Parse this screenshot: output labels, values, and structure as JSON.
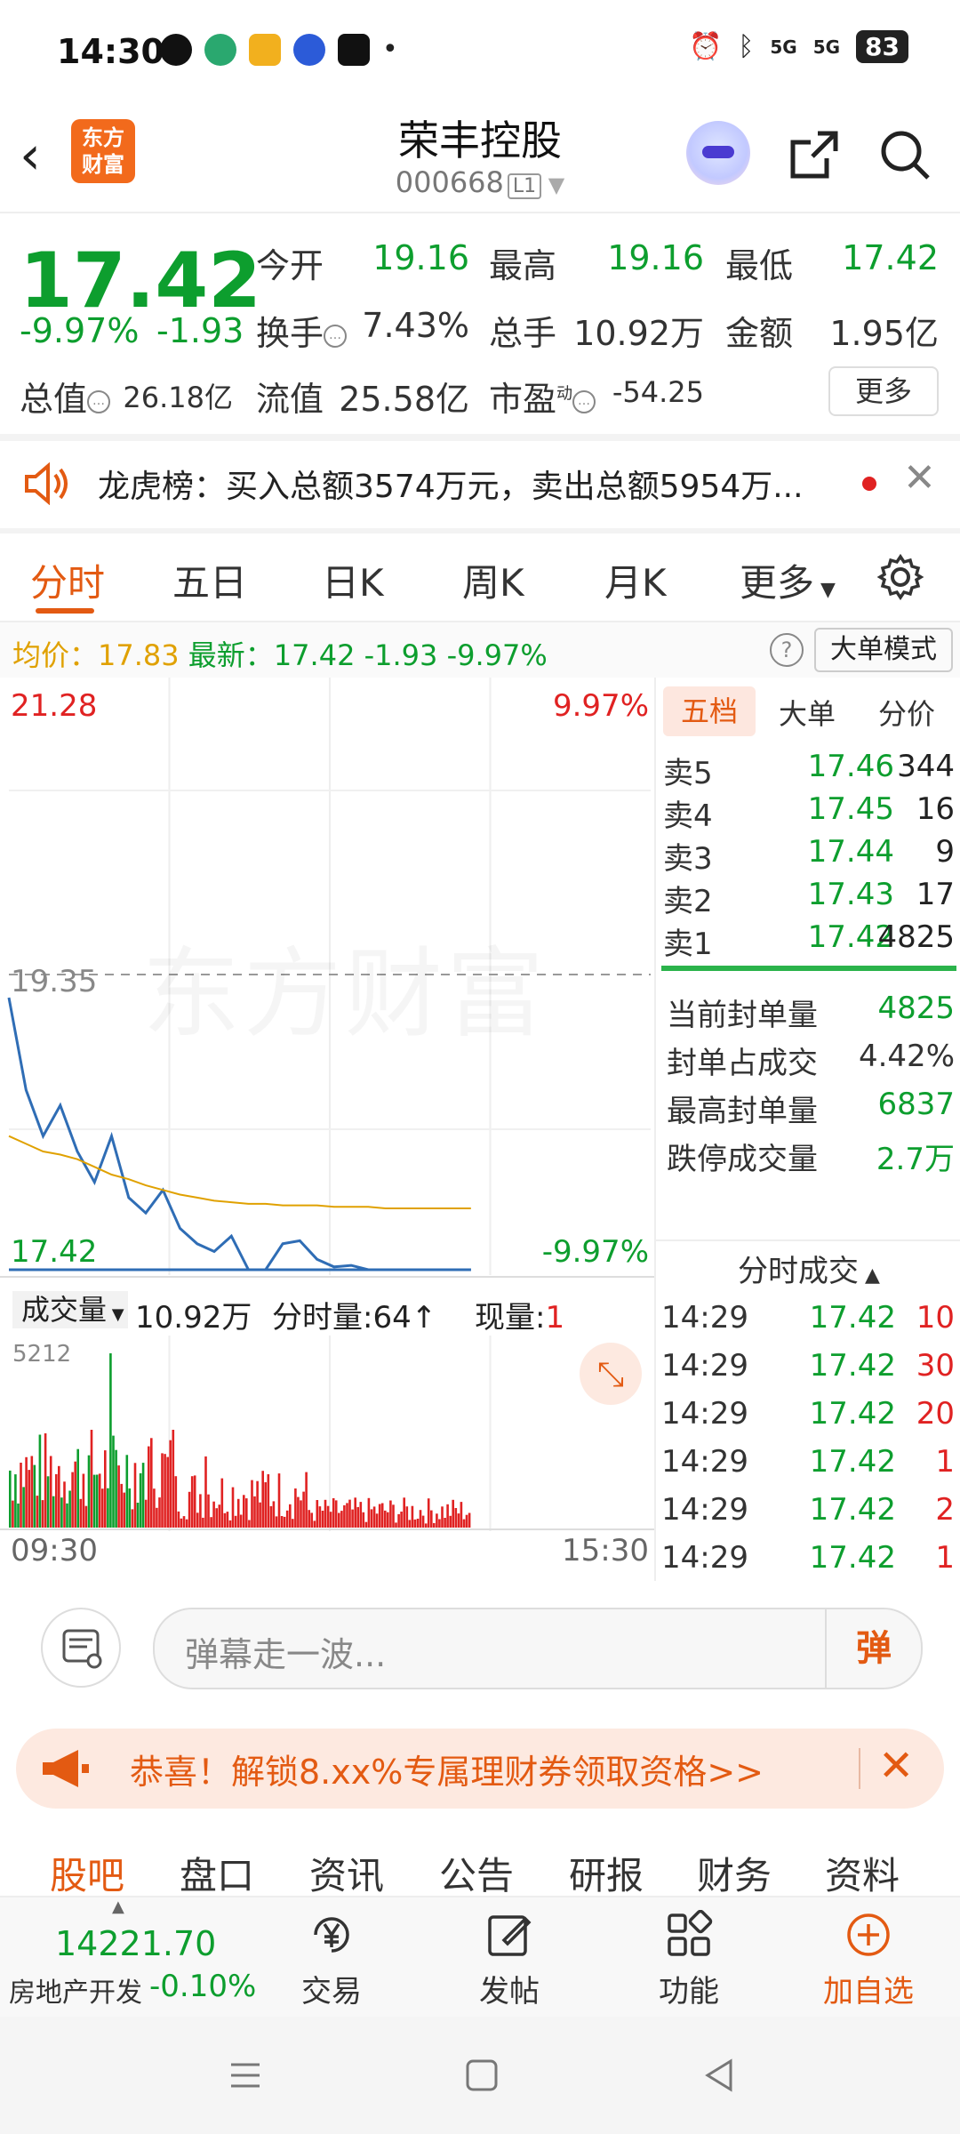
{
  "status_bar": {
    "time": "14:30",
    "battery": "83",
    "signal_labels": [
      "5G",
      "5G"
    ]
  },
  "header": {
    "title": "荣丰控股",
    "code": "000668",
    "level": "L1",
    "logo_line1": "东方",
    "logo_line2": "财富"
  },
  "quote": {
    "price": "17.42",
    "change_pct": "-9.97%",
    "change": "-1.93",
    "open_label": "今开",
    "open": "19.16",
    "high_label": "最高",
    "high": "19.16",
    "low_label": "最低",
    "low": "17.42",
    "turnover_label": "换手",
    "turnover": "7.43%",
    "volume_label": "总手",
    "volume": "10.92万",
    "amount_label": "金额",
    "amount": "1.95亿",
    "mktcap_label": "总值",
    "mktcap": "26.18亿",
    "float_label": "流值",
    "float_cap": "25.58亿",
    "pe_label": "市盈",
    "pe_sup": "动",
    "pe": "-54.25",
    "more_label": "更多"
  },
  "banner": {
    "text": "龙虎榜：买入总额3574万元，卖出总额5954万..."
  },
  "tabs": [
    "分时",
    "五日",
    "日K",
    "周K",
    "月K",
    "更多"
  ],
  "avgline": {
    "avg_label": "均价：",
    "avg": "17.83",
    "latest_label": "最新：",
    "latest": "17.42",
    "chg": "-1.93",
    "pct": "-9.97%",
    "big_mode": "大单模式"
  },
  "chart": {
    "top_price": "21.28",
    "top_pct": "9.97%",
    "ref_price": "19.35",
    "bottom_price": "17.42",
    "bottom_pct": "-9.97%",
    "watermark": "东方财富",
    "vol_label": "成交量",
    "vol_total": "10.92万",
    "tick_vol_label": "分时量:",
    "tick_vol": "64",
    "now_label": "现量:",
    "now_vol": "1",
    "vol_max": "5212",
    "start_time": "09:30",
    "end_time": "15:30"
  },
  "chart_data": {
    "type": "line",
    "series": [
      {
        "values": [
          19.2,
          18.6,
          18.3,
          18.5,
          18.2,
          18.0,
          18.3,
          17.9,
          17.8,
          17.95,
          17.7,
          17.6,
          17.55,
          17.65,
          17.42,
          17.42,
          17.6,
          17.62,
          17.5,
          17.45,
          17.46,
          17.42,
          17.42,
          17.42,
          17.42,
          17.42,
          17.42,
          17.42
        ]
      },
      {
        "values": [
          18.3,
          18.25,
          18.2,
          18.18,
          18.15,
          18.1,
          18.05,
          18.02,
          17.98,
          17.95,
          17.92,
          17.9,
          17.88,
          17.87,
          17.86,
          17.86,
          17.85,
          17.85,
          17.85,
          17.84,
          17.84,
          17.84,
          17.83,
          17.83,
          17.83,
          17.83,
          17.83,
          17.83
        ]
      }
    ],
    "ylim": [
      17.42,
      21.28
    ],
    "reference": 19.35,
    "xlabel": "",
    "ylabel": ""
  },
  "order_book": {
    "tabs": [
      "五档",
      "大单",
      "分价"
    ],
    "asks": [
      {
        "label": "卖5",
        "price": "17.46",
        "qty": "344"
      },
      {
        "label": "卖4",
        "price": "17.45",
        "qty": "16"
      },
      {
        "label": "卖3",
        "price": "17.44",
        "qty": "9"
      },
      {
        "label": "卖2",
        "price": "17.43",
        "qty": "17"
      },
      {
        "label": "卖1",
        "price": "17.42",
        "qty": "4825"
      }
    ],
    "stats": [
      {
        "label": "当前封单量",
        "value": "4825"
      },
      {
        "label": "封单占成交",
        "value": "4.42%"
      },
      {
        "label": "最高封单量",
        "value": "6837"
      },
      {
        "label": "跌停成交量",
        "value": "2.7万"
      }
    ],
    "ticks_title": "分时成交",
    "ticks": [
      {
        "time": "14:29",
        "price": "17.42",
        "qty": "10"
      },
      {
        "time": "14:29",
        "price": "17.42",
        "qty": "30"
      },
      {
        "time": "14:29",
        "price": "17.42",
        "qty": "20"
      },
      {
        "time": "14:29",
        "price": "17.42",
        "qty": "1"
      },
      {
        "time": "14:29",
        "price": "17.42",
        "qty": "2"
      },
      {
        "time": "14:29",
        "price": "17.42",
        "qty": "1"
      }
    ]
  },
  "comment": {
    "placeholder": "弹幕走一波...",
    "send": "弹"
  },
  "promo": {
    "text": "恭喜！解锁8.xx%专属理财券领取资格>>"
  },
  "subtabs": [
    "股吧",
    "盘口",
    "资讯",
    "公告",
    "研报",
    "财务",
    "资料"
  ],
  "bottom_nav": {
    "index_value": "14221.70",
    "index_name": "房地产开发",
    "index_chg": "-0.10%",
    "trade": "交易",
    "post": "发帖",
    "func": "功能",
    "add": "加自选"
  },
  "colors": {
    "down": "#0d9e2e",
    "up": "#e02222",
    "accent": "#e35a12",
    "avg": "#e0a100"
  }
}
